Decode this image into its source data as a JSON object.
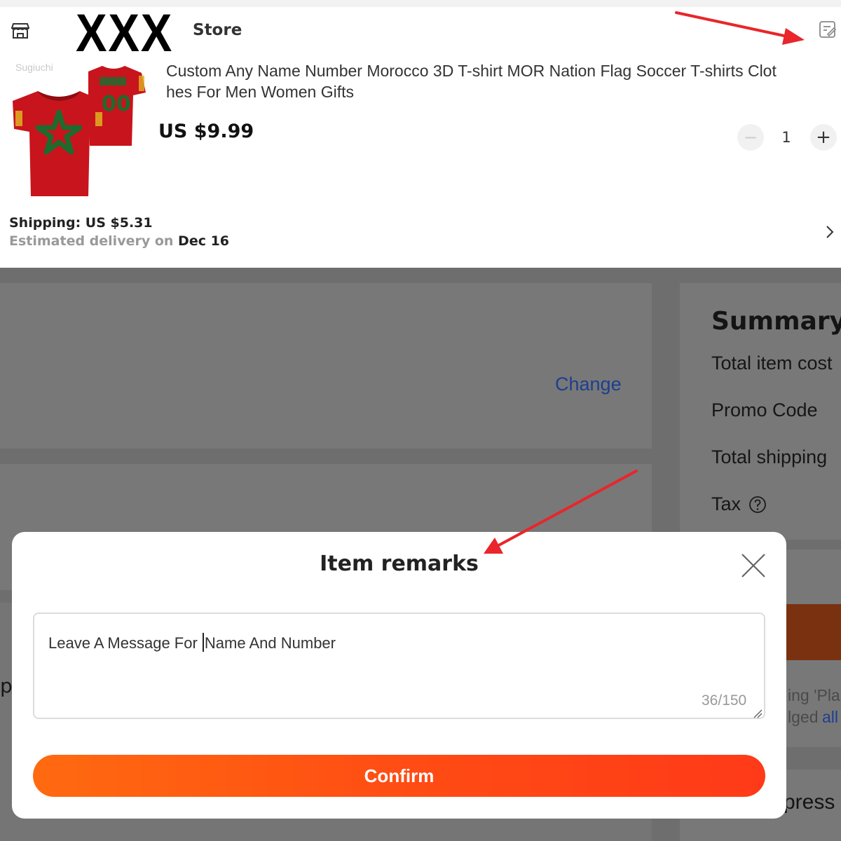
{
  "store": {
    "logo_text": "XXX",
    "name": "Store",
    "icon": "store-icon",
    "edit_icon": "edit-remark-icon"
  },
  "product": {
    "image_watermark": "Sugiuchi",
    "title_line1": "Custom Any Name Number Morocco 3D T-shirt MOR Nation Flag Soccer T-shirts Clot",
    "title_line2": "hes For Men Women Gifts",
    "price": "US $9.99",
    "quantity": "1",
    "minus_symbol": "−",
    "plus_symbol": "+"
  },
  "shipping": {
    "label": "Shipping: US $5.31",
    "estimate_label": "Estimated delivery on ",
    "estimate_date": "Dec 16"
  },
  "background": {
    "change_link": "Change",
    "summary_title": "Summary",
    "rows": {
      "total_item_cost": "Total item cost",
      "promo_code": "Promo Code",
      "total_shipping": "Total shipping",
      "tax": "Tax"
    },
    "notice_line1": "ing 'Pla",
    "notice_line2": "lged ",
    "notice_link": "all",
    "express_fragment": "press",
    "left_fragment": "p"
  },
  "modal": {
    "title": "Item remarks",
    "remark_before_caret": "Leave A Message For ",
    "remark_after_caret": "Name And Number",
    "char_count": "36/150",
    "confirm_label": "Confirm"
  },
  "colors": {
    "accent_orange": "#ff5a12",
    "link_blue": "#1d3f8e",
    "annotation_red": "#e8262b",
    "shirt_red": "#c8141c",
    "star_green": "#1e6b2e"
  }
}
